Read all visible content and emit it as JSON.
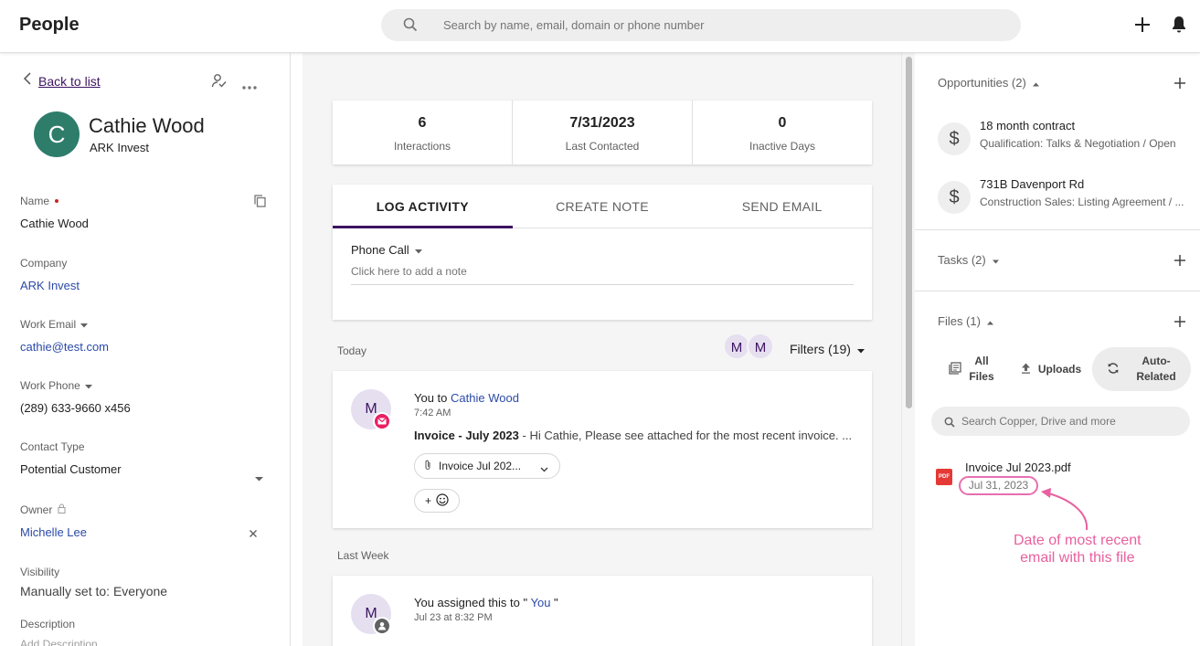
{
  "header": {
    "title": "People",
    "search_placeholder": "Search by name, email, domain or phone number"
  },
  "left": {
    "back_label": "Back to list",
    "avatar_initial": "C",
    "name": "Cathie Wood",
    "company": "ARK Invest",
    "fields": {
      "name_label": "Name",
      "name_value": "Cathie Wood",
      "company_label": "Company",
      "company_value": "ARK Invest",
      "email_label": "Work Email",
      "email_value": "cathie@test.com",
      "phone_label": "Work Phone",
      "phone_value": "(289) 633-9660 x456",
      "contact_type_label": "Contact Type",
      "contact_type_value": "Potential Customer",
      "owner_label": "Owner",
      "owner_value": "Michelle Lee",
      "visibility_label": "Visibility",
      "visibility_value": "Manually set to: Everyone",
      "description_label": "Description",
      "description_placeholder": "Add Description"
    }
  },
  "stats": [
    {
      "value": "6",
      "label": "Interactions"
    },
    {
      "value": "7/31/2023",
      "label": "Last Contacted"
    },
    {
      "value": "0",
      "label": "Inactive Days"
    }
  ],
  "activity": {
    "tabs": [
      "LOG ACTIVITY",
      "CREATE NOTE",
      "SEND EMAIL"
    ],
    "type": "Phone Call",
    "note_placeholder": "Click here to add a note"
  },
  "feed": {
    "today_label": "Today",
    "filter_avatars": [
      "M",
      "M"
    ],
    "filters_label": "Filters (19)",
    "last_week_label": "Last Week",
    "email_card": {
      "avatar": "M",
      "prefix": "You to ",
      "recipient": "Cathie Wood",
      "time": "7:42 AM",
      "subject": "Invoice - July 2023",
      "snippet": " - Hi Cathie, Please see attached for the most recent invoice. ...",
      "attachment": "Invoice Jul 202...",
      "reaction_plus": "+"
    },
    "assign_card": {
      "avatar": "M",
      "text_prefix": "You assigned this to \"",
      "text_link": " You",
      "text_suffix": " \"",
      "time": "Jul 23 at 8:32 PM"
    }
  },
  "right": {
    "opportunities_label": "Opportunities (2)",
    "opportunities": [
      {
        "title": "18 month contract",
        "subtitle": "Qualification: Talks & Negotiation / Open"
      },
      {
        "title": "731B Davenport Rd",
        "subtitle": "Construction Sales: Listing Agreement / ..."
      }
    ],
    "tasks_label": "Tasks (2)",
    "files_label": "Files (1)",
    "file_tabs": [
      {
        "line1": "All",
        "line2": "Files"
      },
      {
        "line1": "Uploads",
        "line2": ""
      },
      {
        "line1": "Auto-",
        "line2": "Related"
      }
    ],
    "search_placeholder": "Search Copper, Drive and more",
    "file": {
      "name": "Invoice Jul 2023.pdf",
      "date": "Jul 31, 2023",
      "type_badge": "PDF"
    },
    "callout_line1": "Date of most recent",
    "callout_line2": "email with this file"
  },
  "colors": {
    "accent": "#3c1361",
    "link": "#2b4aa8",
    "avatar": "#2e7d6b",
    "callout": "#e8609f"
  }
}
